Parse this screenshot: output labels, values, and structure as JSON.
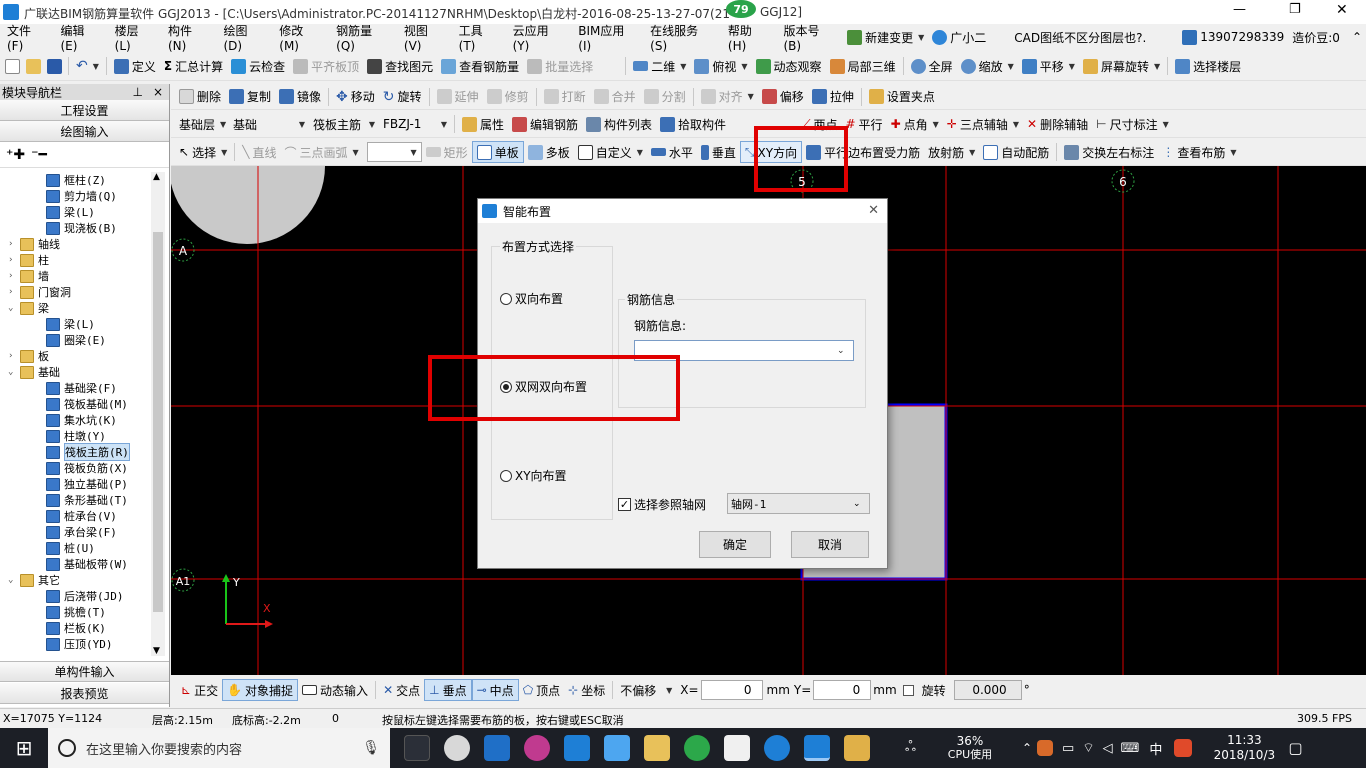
{
  "titlebar": {
    "title": "广联达BIM钢筋算量软件 GGJ2013 - [C:\\Users\\Administrator.PC-20141127NRHM\\Desktop\\白龙村-2016-08-25-13-27-07(21",
    "title_tail": "GGJ12]",
    "badge": "79",
    "min": "—",
    "max": "❐",
    "close": "✕"
  },
  "menubar": {
    "items": [
      "文件(F)",
      "编辑(E)",
      "楼层(L)",
      "构件(N)",
      "绘图(D)",
      "修改(M)",
      "钢筋量(Q)",
      "视图(V)",
      "工具(T)",
      "云应用(Y)",
      "BIM应用(I)",
      "在线服务(S)",
      "帮助(H)",
      "版本号(B)"
    ],
    "new_change": "新建变更",
    "assistant": "广小二",
    "cad_tip": "CAD图纸不区分图层也?.",
    "phone": "13907298339",
    "price": "造价豆:0"
  },
  "toolbar1": {
    "define": "定义",
    "sum_calc": "汇总计算",
    "cloud_check": "云检查",
    "level_slab": "平齐板顶",
    "find_elem": "查找图元",
    "view_rebar": "查看钢筋量",
    "batch_select": "批量选择",
    "view_2d": "二维",
    "view_top": "俯视",
    "dyn_view": "动态观察",
    "local_3d": "局部三维",
    "fullscreen": "全屏",
    "zoom": "缩放",
    "pan": "平移",
    "screen_rotate": "屏幕旋转",
    "select_floor": "选择楼层"
  },
  "toolbar2": {
    "delete": "删除",
    "copy": "复制",
    "mirror": "镜像",
    "move": "移动",
    "rotate": "旋转",
    "extend": "延伸",
    "trim": "修剪",
    "break": "打断",
    "merge": "合并",
    "split": "分割",
    "align": "对齐",
    "offset": "偏移",
    "stretch": "拉伸",
    "set_point": "设置夹点"
  },
  "toolbar3": {
    "layer": "基础层",
    "category": "基础",
    "type": "筏板主筋",
    "code": "FBZJ-1",
    "props": "属性",
    "edit_rebar": "编辑钢筋",
    "comp_list": "构件列表",
    "pick_comp": "拾取构件",
    "two_points": "两点",
    "parallel": "平行",
    "point_angle": "点角",
    "three_point_axis": "三点辅轴",
    "del_axis": "删除辅轴",
    "dim": "尺寸标注"
  },
  "toolbar4": {
    "select": "选择",
    "line": "直线",
    "arc": "三点画弧",
    "rect": "矩形",
    "single": "单板",
    "multi": "多板",
    "custom": "自定义",
    "horizontal": "水平",
    "vertical": "垂直",
    "xy_dir": "XY方向",
    "parallel_edge": "平行边布置受力筋",
    "radial": "放射筋",
    "auto_rebar": "自动配筋",
    "swap_dim": "交换左右标注",
    "view_layout": "查看布筋"
  },
  "navigator": {
    "title": "模块导航栏",
    "pin": "ꟷ",
    "close": "×",
    "project_settings": "工程设置",
    "draw_input": "绘图输入",
    "single_input": "单构件输入",
    "report_preview": "报表预览",
    "tree": [
      {
        "label": "框柱(Z)",
        "level": 2,
        "exp": ""
      },
      {
        "label": "剪力墙(Q)",
        "level": 2,
        "exp": ""
      },
      {
        "label": "梁(L)",
        "level": 2,
        "exp": ""
      },
      {
        "label": "现浇板(B)",
        "level": 2,
        "exp": ""
      },
      {
        "label": "轴线",
        "level": 1,
        "exp": "›"
      },
      {
        "label": "柱",
        "level": 1,
        "exp": "›"
      },
      {
        "label": "墙",
        "level": 1,
        "exp": "›"
      },
      {
        "label": "门窗洞",
        "level": 1,
        "exp": "›"
      },
      {
        "label": "梁",
        "level": 1,
        "exp": "⌄"
      },
      {
        "label": "梁(L)",
        "level": 2,
        "exp": ""
      },
      {
        "label": "圈梁(E)",
        "level": 2,
        "exp": ""
      },
      {
        "label": "板",
        "level": 1,
        "exp": "›"
      },
      {
        "label": "基础",
        "level": 1,
        "exp": "⌄"
      },
      {
        "label": "基础梁(F)",
        "level": 2,
        "exp": ""
      },
      {
        "label": "筏板基础(M)",
        "level": 2,
        "exp": ""
      },
      {
        "label": "集水坑(K)",
        "level": 2,
        "exp": ""
      },
      {
        "label": "柱墩(Y)",
        "level": 2,
        "exp": ""
      },
      {
        "label": "筏板主筋(R)",
        "level": 2,
        "exp": "",
        "selected": true
      },
      {
        "label": "筏板负筋(X)",
        "level": 2,
        "exp": ""
      },
      {
        "label": "独立基础(P)",
        "level": 2,
        "exp": ""
      },
      {
        "label": "条形基础(T)",
        "level": 2,
        "exp": ""
      },
      {
        "label": "桩承台(V)",
        "level": 2,
        "exp": ""
      },
      {
        "label": "承台梁(F)",
        "level": 2,
        "exp": ""
      },
      {
        "label": "桩(U)",
        "level": 2,
        "exp": ""
      },
      {
        "label": "基础板带(W)",
        "level": 2,
        "exp": ""
      },
      {
        "label": "其它",
        "level": 1,
        "exp": "⌄"
      },
      {
        "label": "后浇带(JD)",
        "level": 2,
        "exp": ""
      },
      {
        "label": "挑檐(T)",
        "level": 2,
        "exp": ""
      },
      {
        "label": "栏板(K)",
        "level": 2,
        "exp": ""
      },
      {
        "label": "压顶(YD)",
        "level": 2,
        "exp": ""
      }
    ]
  },
  "canvas": {
    "axis_5": "5",
    "axis_6": "6",
    "axis_A": "A",
    "axis_A1": "A1",
    "ucs_y": "Y",
    "ucs_x": "X"
  },
  "dialog": {
    "title": "智能布置",
    "close": "✕",
    "group_mode": "布置方式选择",
    "opt_two_way": "双向布置",
    "opt_double_net": "双网双向布置",
    "opt_xy": "XY向布置",
    "rebar_info_group": "钢筋信息",
    "rebar_info_label": "钢筋信息:",
    "rebar_info_value": "",
    "ref_grid_label": "选择参照轴网",
    "ref_grid_value": "轴网-1",
    "ok": "确定",
    "cancel": "取消"
  },
  "bottombar": {
    "ortho": "正交",
    "snap": "对象捕捉",
    "dyn_input": "动态输入",
    "intersect": "交点",
    "perp": "垂点",
    "mid": "中点",
    "vertex": "顶点",
    "coord": "坐标",
    "offset_mode": "不偏移",
    "x_label": "X=",
    "x_value": "0",
    "mm1": "mm",
    "y_label": "Y=",
    "y_value": "0",
    "mm2": "mm",
    "rotate": "旋转",
    "rotate_value": "0.000",
    "deg": "°"
  },
  "statusbar": {
    "coords": "X=17075 Y=1124",
    "floor_height": "层高:2.15m",
    "bottom_height": "底标高:-2.2m",
    "num": "0",
    "hint": "按鼠标左键选择需要布筋的板，按右键或ESC取消",
    "fps": "309.5 FPS"
  },
  "taskbar": {
    "search_placeholder": "在这里输入你要搜索的内容",
    "cpu_pct": "36%",
    "cpu_label": "CPU使用",
    "ime": "中",
    "time": "11:33",
    "date": "2018/10/3"
  }
}
